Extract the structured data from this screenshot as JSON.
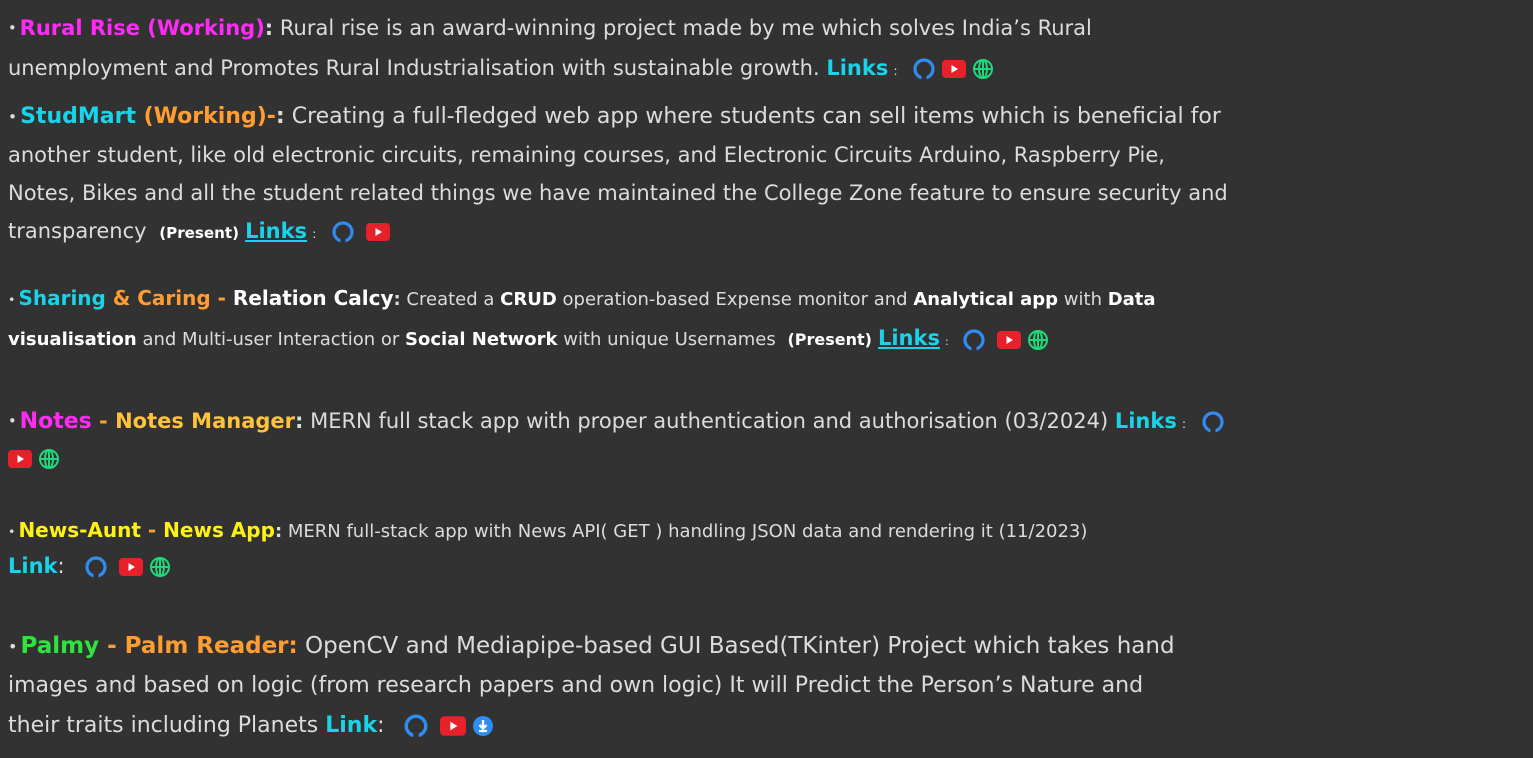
{
  "bullet": "•",
  "icons": {
    "github": "github-icon",
    "youtube": "youtube-icon",
    "website": "globe-icon",
    "download": "download-icon"
  },
  "colors": {
    "background": "#323233",
    "text": "#dcdcdc",
    "magenta": "#ff2bf5",
    "cyan": "#19d3e8",
    "orange": "#ff9d30",
    "yellow": "#fff016",
    "green": "#2de53d",
    "youtube": "#e8202a",
    "globe": "#1fd87a",
    "download": "#2f8cf0"
  },
  "rural": {
    "title": "Rural Rise (Working)",
    "sep": ":",
    "desc_l1": " Rural rise is an award-winning project made by me which solves India’s Rural",
    "desc_l2": "unemployment and Promotes Rural Industrialisation with sustainable growth. ",
    "links": "Links",
    "links_colon": ":"
  },
  "studmart": {
    "title": "StudMart",
    "status": " (Working)-",
    "sep": ":",
    "desc_l1": " Creating a full-fledged web app where students can sell items which is beneficial for",
    "desc_l2": "another student, like old electronic circuits, remaining courses, and  Electronic Circuits Arduino, Raspberry Pie,",
    "desc_l3": "Notes, Bikes and all the student related things we have maintained the College Zone feature to ensure security and",
    "desc_l4": "transparency ",
    "present": "(Present)",
    "links": "Links",
    "links_colon": ":"
  },
  "sharing": {
    "title_a": "Sharing ",
    "title_b": "& Caring - ",
    "subtitle": "Relation Calcy",
    "sep": ":",
    "d1": " Created a ",
    "crud": "CRUD",
    "d2": " operation-based Expense monitor and ",
    "analytical": "Analytical app",
    "d3": " with ",
    "data": "Data",
    "visualisation": "visualisation",
    "d4": " and Multi-user Interaction or ",
    "social": "Social Network",
    "d5": " with unique Usernames ",
    "present": "(Present)",
    "links": "Links",
    "links_colon": ":"
  },
  "notes": {
    "title": "Notes",
    "dash": " - ",
    "subtitle": "Notes Manager",
    "sep": ":",
    "desc": " MERN full stack app with proper authentication and authorisation (03/2024) ",
    "links": "Links",
    "links_colon": ":"
  },
  "news": {
    "title": "News-Aunt",
    "dash": " - ",
    "subtitle": "News App",
    "sep": ":",
    "desc": " MERN full-stack app with News API( GET ) handling JSON data and rendering it (11/2023)",
    "link": "Link",
    "link_colon": ":"
  },
  "palmy": {
    "title": "Palmy",
    "dash": " - ",
    "subtitle": "Palm Reader:",
    "desc_l1": " OpenCV and Mediapipe-based GUI Based(TKinter) Project which takes hand",
    "desc_l2": "images and based on logic (from research papers and own logic) It will Predict the Person’s Nature and",
    "desc_l3": "their traits including Planets ",
    "link": "Link",
    "link_colon": ":"
  }
}
